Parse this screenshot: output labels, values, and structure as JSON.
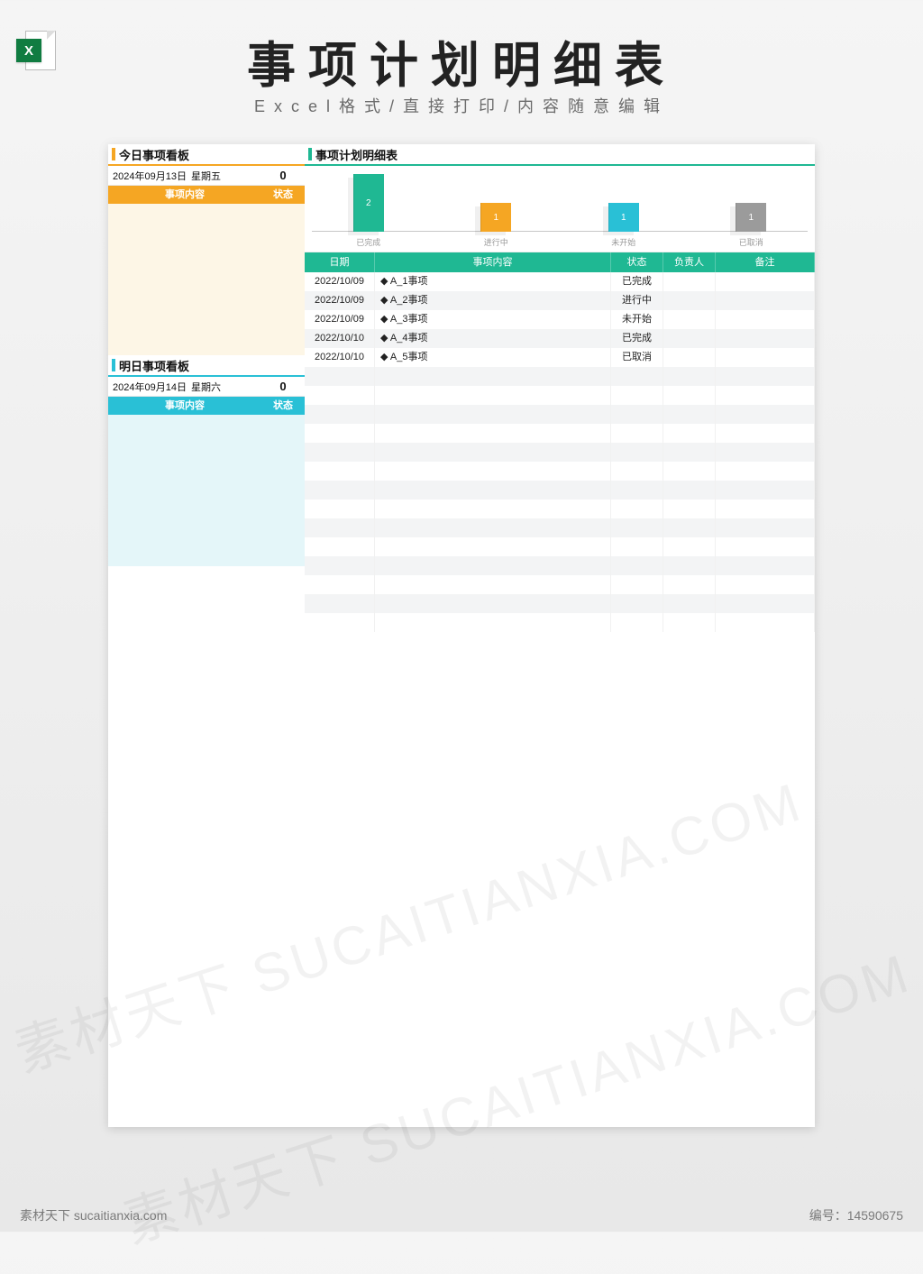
{
  "page": {
    "title": "事项计划明细表",
    "subtitle": "Excel格式/直接打印/内容随意编辑"
  },
  "excel_icon": {
    "letter": "X"
  },
  "left": {
    "today": {
      "title": "今日事项看板",
      "date": "2024年09月13日",
      "weekday": "星期五",
      "count": "0",
      "hdr_content": "事项内容",
      "hdr_status": "状态",
      "accent": "#f5a623"
    },
    "tomorrow": {
      "title": "明日事项看板",
      "date": "2024年09月14日",
      "weekday": "星期六",
      "count": "0",
      "hdr_content": "事项内容",
      "hdr_status": "状态",
      "accent": "#29c0d6"
    }
  },
  "main": {
    "title": "事项计划明细表",
    "accent": "#1fb893",
    "grid_header": {
      "date": "日期",
      "content": "事项内容",
      "status": "状态",
      "owner": "负责人",
      "note": "备注"
    },
    "rows": [
      {
        "date": "2022/10/09",
        "content": "◆ A_1事项",
        "status": "已完成",
        "owner": "",
        "note": ""
      },
      {
        "date": "2022/10/09",
        "content": "◆ A_2事项",
        "status": "进行中",
        "owner": "",
        "note": ""
      },
      {
        "date": "2022/10/09",
        "content": "◆ A_3事项",
        "status": "未开始",
        "owner": "",
        "note": ""
      },
      {
        "date": "2022/10/10",
        "content": "◆ A_4事项",
        "status": "已完成",
        "owner": "",
        "note": ""
      },
      {
        "date": "2022/10/10",
        "content": "◆ A_5事项",
        "status": "已取消",
        "owner": "",
        "note": ""
      }
    ],
    "empty_rows": 14
  },
  "chart_data": {
    "type": "bar",
    "categories": [
      "已完成",
      "进行中",
      "未开始",
      "已取消"
    ],
    "values": [
      2,
      1,
      1,
      1
    ],
    "colors": [
      "#1fb893",
      "#f5a623",
      "#29c0d6",
      "#9b9b9b"
    ],
    "max": 2
  },
  "watermark": "素材天下 SUCAITIANXIA.COM",
  "footer": {
    "left": "素材天下 sucaitianxia.com",
    "right_label": "编号：",
    "right_value": "14590675"
  }
}
